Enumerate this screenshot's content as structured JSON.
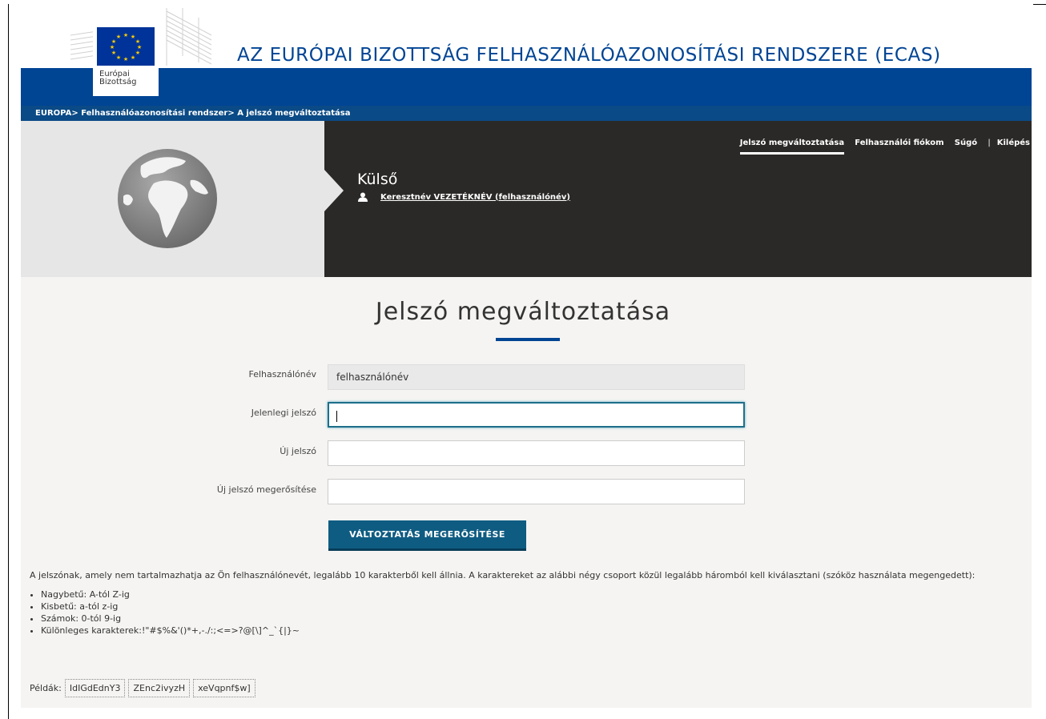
{
  "header": {
    "logo_line1": "Európai",
    "logo_line2": "Bizottság",
    "site_title": "AZ EURÓPAI BIZOTTSÁG FELHASZNÁLÓAZONOSÍTÁSI RENDSZERE (ECAS)"
  },
  "breadcrumb": {
    "items": [
      "EUROPA",
      "Felhasználóazonosítási rendszer",
      "A jelszó megváltoztatása"
    ],
    "separator": ">"
  },
  "topnav": {
    "items": [
      "Jelszó megváltoztatása",
      "Felhasználói fiókom",
      "Súgó",
      "Kilépés"
    ],
    "active_index": 0,
    "separator": "|"
  },
  "banner": {
    "env_title": "Külső",
    "user_link": "Keresztnév VEZETÉKNÉV (felhasználónév)"
  },
  "form": {
    "heading": "Jelszó megváltoztatása",
    "fields": [
      {
        "label": "Felhasználónév",
        "value": "felhasználónév"
      },
      {
        "label": "Jelenlegi jelszó",
        "value": ""
      },
      {
        "label": "Új jelszó",
        "value": ""
      },
      {
        "label": "Új jelszó megerősítése",
        "value": ""
      }
    ],
    "submit_label": "VÁLTOZTATÁS MEGERŐSÍTÉSE"
  },
  "rules": {
    "intro": "A jelszónak, amely nem tartalmazhatja az Ön felhasználónevét, legalább 10 karakterből kell állnia. A karaktereket az alábbi négy csoport közül legalább háromból kell kiválasztani (szóköz használata megengedett):",
    "items": [
      "Nagybetű: A-tól Z-ig",
      "Kisbetű: a-tól z-ig",
      "Számok: 0-tól 9-ig",
      "Különleges karakterek:!\"#$%&'()*+,-./:;<=>?@[\\]^_`{|}~"
    ]
  },
  "examples": {
    "label": "Példák:",
    "items": [
      "IdIGdEdnY3",
      "ZEnc2ivyzH",
      "xeVqpnf$w]"
    ]
  },
  "colors": {
    "eu_blue": "#004494",
    "breadcrumb_bg": "#0a4a86",
    "banner_dark": "#2b2927",
    "button": "#0f5c82"
  }
}
